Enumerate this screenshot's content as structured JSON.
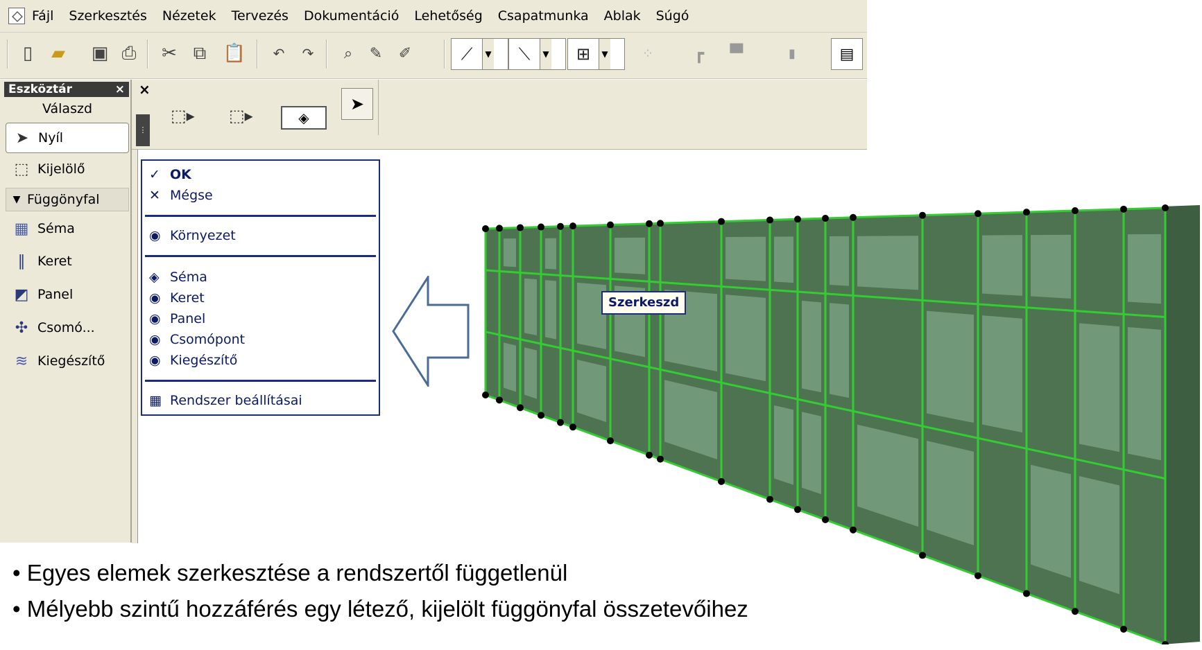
{
  "menubar": {
    "items": [
      "Fájl",
      "Szerkesztés",
      "Nézetek",
      "Tervezés",
      "Dokumentáció",
      "Lehetőség",
      "Csapatmunka",
      "Ablak",
      "Súgó"
    ]
  },
  "toolbox": {
    "title": "Eszköztár",
    "close": "×",
    "select_label": "Válaszd",
    "tools": [
      {
        "label": "Nyíl",
        "icon": "arrow-pointer-icon"
      },
      {
        "label": "Kijelölő",
        "icon": "marquee-icon"
      }
    ],
    "group_label": "Függönyfal",
    "group_tools": [
      {
        "label": "Séma",
        "icon": "scheme-icon"
      },
      {
        "label": "Keret",
        "icon": "frame-icon"
      },
      {
        "label": "Panel",
        "icon": "panel-icon"
      },
      {
        "label": "Csomó...",
        "icon": "junction-icon"
      },
      {
        "label": "Kiegészítő",
        "icon": "accessory-icon"
      }
    ]
  },
  "infobox": {
    "close": "×"
  },
  "context_menu": {
    "ok": "OK",
    "cancel": "Mégse",
    "environment": "Környezet",
    "components": [
      "Séma",
      "Keret",
      "Panel",
      "Csomópont",
      "Kiegészítő"
    ],
    "system_settings": "Rendszer beállításai"
  },
  "wall_label": "Szerkeszd",
  "bullets": [
    "• Egyes elemek szerkesztése a rendszertől függetlenül",
    "• Mélyebb szintű hozzáférés egy létező, kijelölt függönyfal összetevőihez"
  ],
  "colors": {
    "wall_frame": "#33cc33",
    "wall_body": "#4e7350",
    "panel_glass": "#7fa488",
    "menu_text": "#0b1a66"
  }
}
